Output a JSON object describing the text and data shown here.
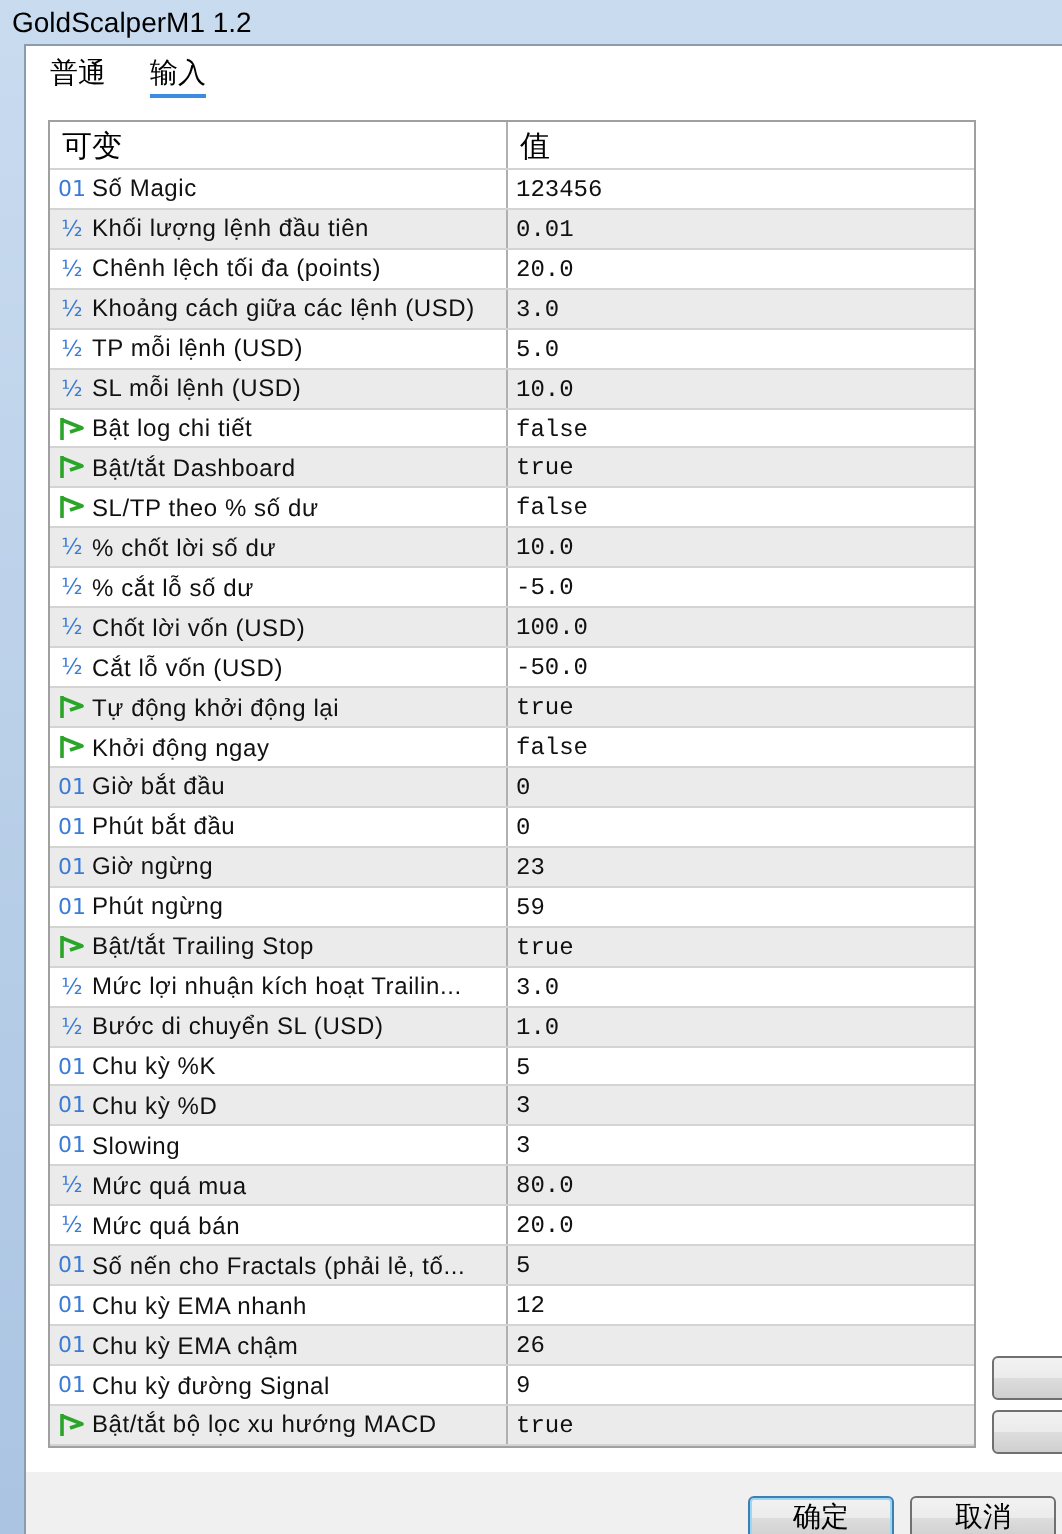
{
  "window": {
    "title": "GoldScalperM1 1.2"
  },
  "tabs": [
    {
      "label": "普通",
      "selected": false
    },
    {
      "label": "输入",
      "selected": true
    }
  ],
  "table": {
    "columns": [
      "可变",
      "值"
    ],
    "rows": [
      {
        "kind": "int",
        "icon": "01",
        "name": "Số Magic",
        "value": "123456"
      },
      {
        "kind": "double",
        "icon": "½",
        "name": "Khối lượng lệnh đầu tiên",
        "value": "0.01"
      },
      {
        "kind": "double",
        "icon": "½",
        "name": "Chênh lệch tối đa (points)",
        "value": "20.0"
      },
      {
        "kind": "double",
        "icon": "½",
        "name": "Khoảng cách giữa các lệnh (USD)",
        "value": "3.0"
      },
      {
        "kind": "double",
        "icon": "½",
        "name": "TP mỗi lệnh (USD)",
        "value": "5.0"
      },
      {
        "kind": "double",
        "icon": "½",
        "name": "SL mỗi lệnh (USD)",
        "value": "10.0"
      },
      {
        "kind": "bool",
        "name": "Bật log chi tiết",
        "value": "false"
      },
      {
        "kind": "bool",
        "name": "Bật/tắt Dashboard",
        "value": "true"
      },
      {
        "kind": "bool",
        "name": "SL/TP theo % số dư",
        "value": "false"
      },
      {
        "kind": "double",
        "icon": "½",
        "name": "% chốt lời số dư",
        "value": "10.0"
      },
      {
        "kind": "double",
        "icon": "½",
        "name": "% cắt lỗ số dư",
        "value": "-5.0"
      },
      {
        "kind": "double",
        "icon": "½",
        "name": "Chốt lời vốn (USD)",
        "value": "100.0"
      },
      {
        "kind": "double",
        "icon": "½",
        "name": "Cắt lỗ vốn (USD)",
        "value": "-50.0"
      },
      {
        "kind": "bool",
        "name": "Tự động khởi động lại",
        "value": "true"
      },
      {
        "kind": "bool",
        "name": "Khởi động ngay",
        "value": "false"
      },
      {
        "kind": "int",
        "icon": "01",
        "name": "Giờ bắt đầu",
        "value": "0"
      },
      {
        "kind": "int",
        "icon": "01",
        "name": "Phút bắt đầu",
        "value": "0"
      },
      {
        "kind": "int",
        "icon": "01",
        "name": "Giờ ngừng",
        "value": "23"
      },
      {
        "kind": "int",
        "icon": "01",
        "name": "Phút ngừng",
        "value": "59"
      },
      {
        "kind": "bool",
        "name": "Bật/tắt Trailing Stop",
        "value": "true"
      },
      {
        "kind": "double",
        "icon": "½",
        "name": "Mức lợi nhuận kích hoạt Trailin...",
        "value": "3.0"
      },
      {
        "kind": "double",
        "icon": "½",
        "name": "Bước di chuyển SL (USD)",
        "value": "1.0"
      },
      {
        "kind": "int",
        "icon": "01",
        "name": "Chu kỳ %K",
        "value": "5"
      },
      {
        "kind": "int",
        "icon": "01",
        "name": "Chu kỳ %D",
        "value": "3"
      },
      {
        "kind": "int",
        "icon": "01",
        "name": "Slowing",
        "value": "3"
      },
      {
        "kind": "double",
        "icon": "½",
        "name": "Mức quá mua",
        "value": "80.0"
      },
      {
        "kind": "double",
        "icon": "½",
        "name": "Mức quá bán",
        "value": "20.0"
      },
      {
        "kind": "int",
        "icon": "01",
        "name": "Số nến cho Fractals (phải lẻ, tố...",
        "value": "5"
      },
      {
        "kind": "int",
        "icon": "01",
        "name": "Chu kỳ EMA nhanh",
        "value": "12"
      },
      {
        "kind": "int",
        "icon": "01",
        "name": "Chu kỳ EMA chậm",
        "value": "26"
      },
      {
        "kind": "int",
        "icon": "01",
        "name": "Chu kỳ đường Signal",
        "value": "9"
      },
      {
        "kind": "bool",
        "name": "Bật/tắt bộ lọc xu hướng MACD",
        "value": "true"
      }
    ]
  },
  "side_buttons": [
    {
      "kind": "button"
    },
    {
      "kind": "button"
    }
  ],
  "buttons": [
    {
      "label": "确定",
      "default": true
    },
    {
      "label": "取消",
      "default": false
    }
  ]
}
